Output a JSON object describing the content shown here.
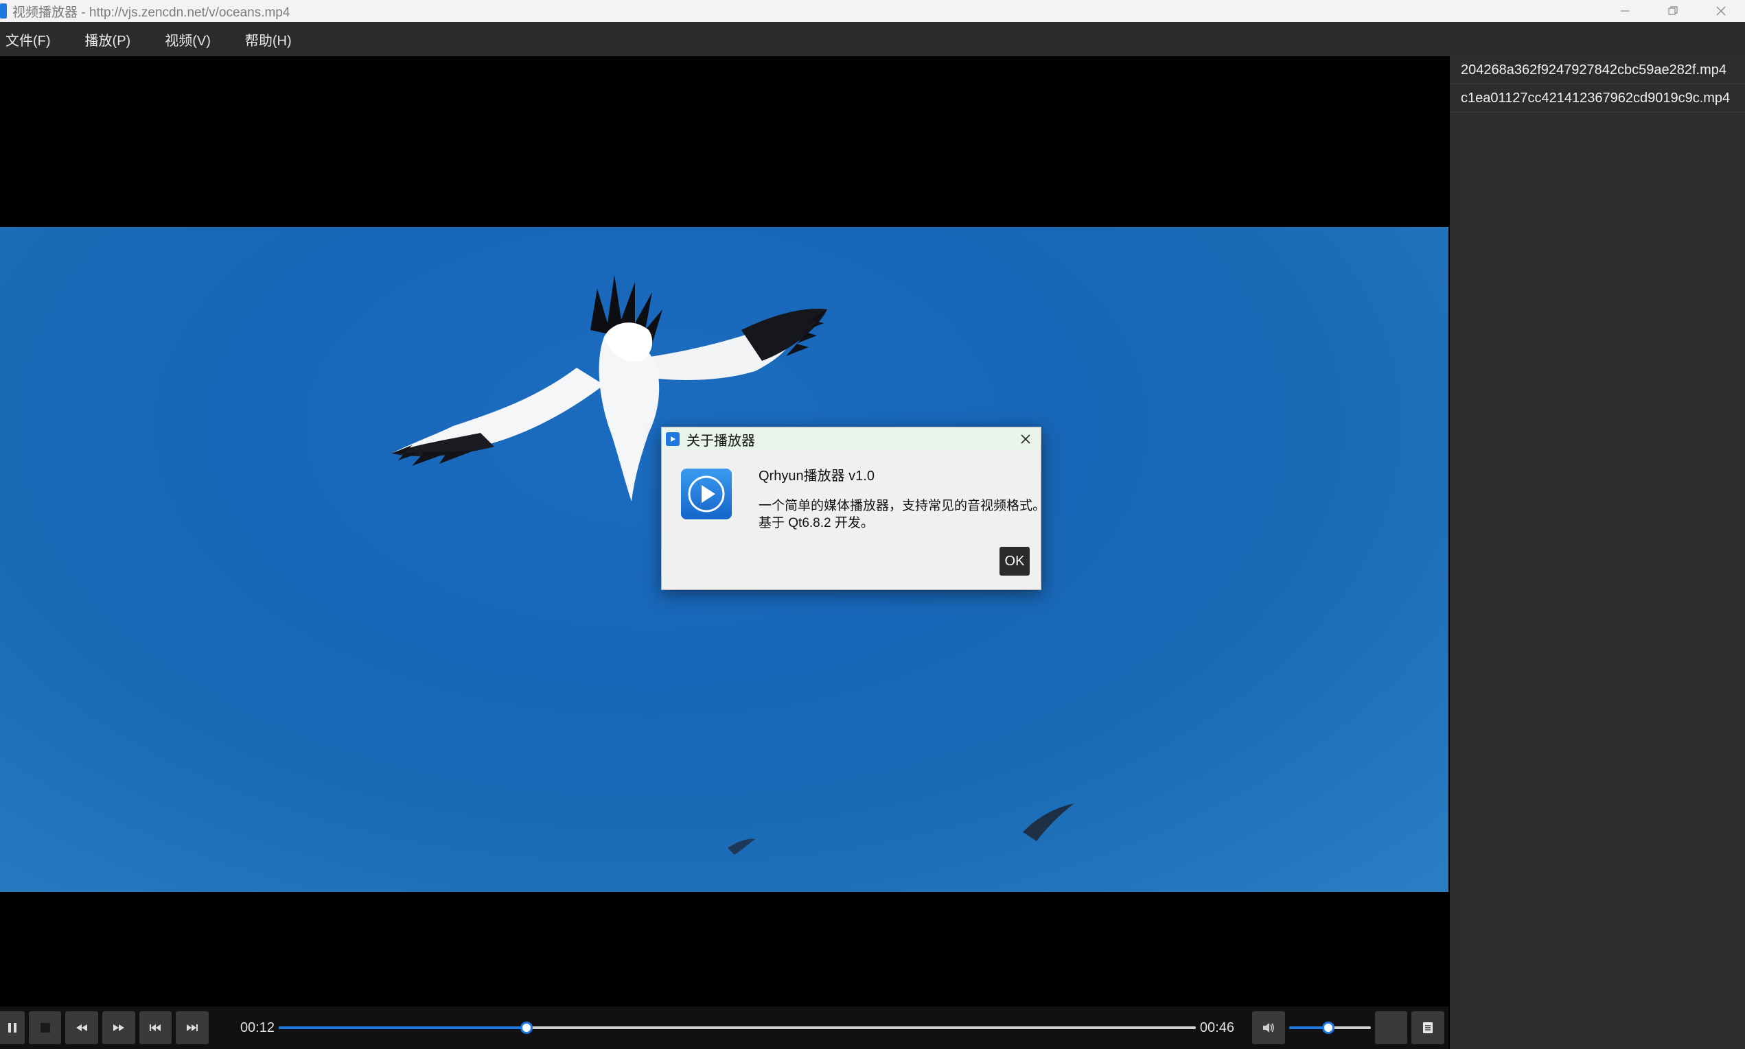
{
  "window": {
    "title": "视频播放器 - http://vjs.zencdn.net/v/oceans.mp4"
  },
  "menu": {
    "items": [
      {
        "label": "文件(F)"
      },
      {
        "label": "播放(P)"
      },
      {
        "label": "视频(V)"
      },
      {
        "label": "帮助(H)"
      }
    ]
  },
  "playlist": {
    "items": [
      {
        "label": "204268a362f9247927842cbc59ae282f.mp4"
      },
      {
        "label": "c1ea01127cc421412367962cd9019c9c.mp4"
      }
    ]
  },
  "controls": {
    "current_time": "00:12",
    "total_time": "00:46",
    "progress_fraction": 0.27,
    "volume_fraction": 0.48
  },
  "dialog": {
    "title": "关于播放器",
    "app_name": "Qrhyun播放器 v1.0",
    "description_line1": "一个简单的媒体播放器，支持常见的音视频格式。",
    "description_line2": "基于 Qt6.8.2 开发。",
    "ok_label": "OK"
  },
  "colors": {
    "accent": "#1f78e0",
    "menubar_bg": "#2b2b2b",
    "playlist_bg": "#2d2d2d",
    "video_sky": "#1a69b8"
  },
  "icons": [
    "app-icon",
    "minimize-icon",
    "restore-icon",
    "close-icon",
    "pause-icon",
    "stop-icon",
    "rewind-icon",
    "fast-forward-icon",
    "previous-icon",
    "next-icon",
    "volume-icon",
    "playlist-toggle-icon",
    "play-logo-icon"
  ]
}
